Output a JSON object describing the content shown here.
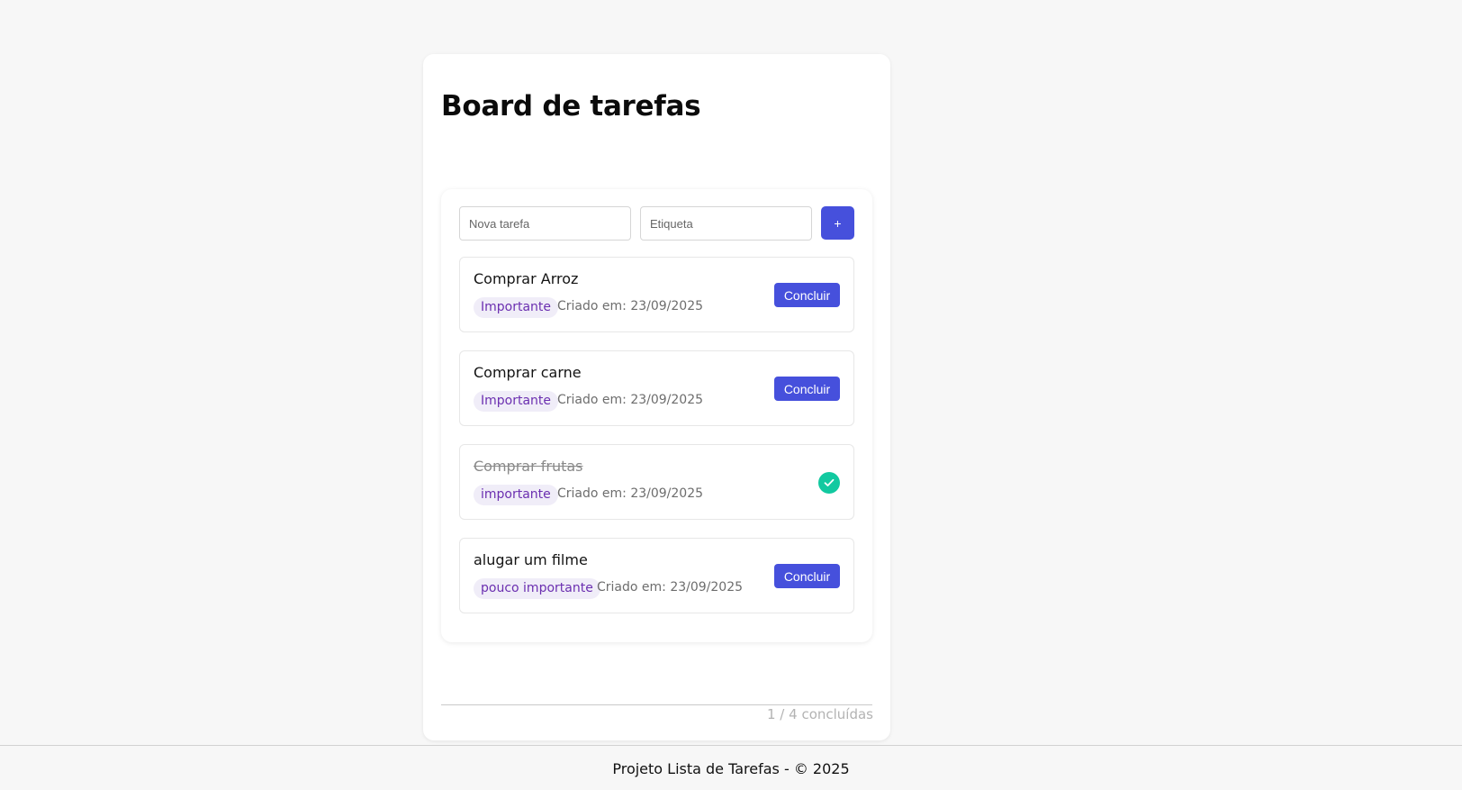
{
  "board": {
    "title": "Board de tarefas"
  },
  "form": {
    "task_placeholder": "Nova tarefa",
    "label_placeholder": "Etiqueta",
    "task_value": "",
    "label_value": "",
    "add_label": "+"
  },
  "tasks": [
    {
      "title": "Comprar Arroz",
      "tag": "Importante",
      "created": "Criado em: 23/09/2025",
      "done": false,
      "action_label": "Concluir"
    },
    {
      "title": "Comprar carne",
      "tag": "Importante",
      "created": "Criado em: 23/09/2025",
      "done": false,
      "action_label": "Concluir"
    },
    {
      "title": "Comprar frutas",
      "tag": "importante",
      "created": "Criado em: 23/09/2025",
      "done": true,
      "status_icon": "check-circle-icon"
    },
    {
      "title": "alugar um filme",
      "tag": "pouco importante",
      "created": "Criado em: 23/09/2025",
      "done": false,
      "action_label": "Concluir"
    }
  ],
  "counter": {
    "text": "1 / 4 concluídas"
  },
  "footer": {
    "text": "Projeto Lista de Tarefas - © 2025"
  },
  "colors": {
    "accent": "#4650dc",
    "done_badge": "#12c9a0",
    "tag_background": "#f0edf8",
    "tag_text": "#6b2fb0",
    "page_background": "#f7f7f7"
  }
}
